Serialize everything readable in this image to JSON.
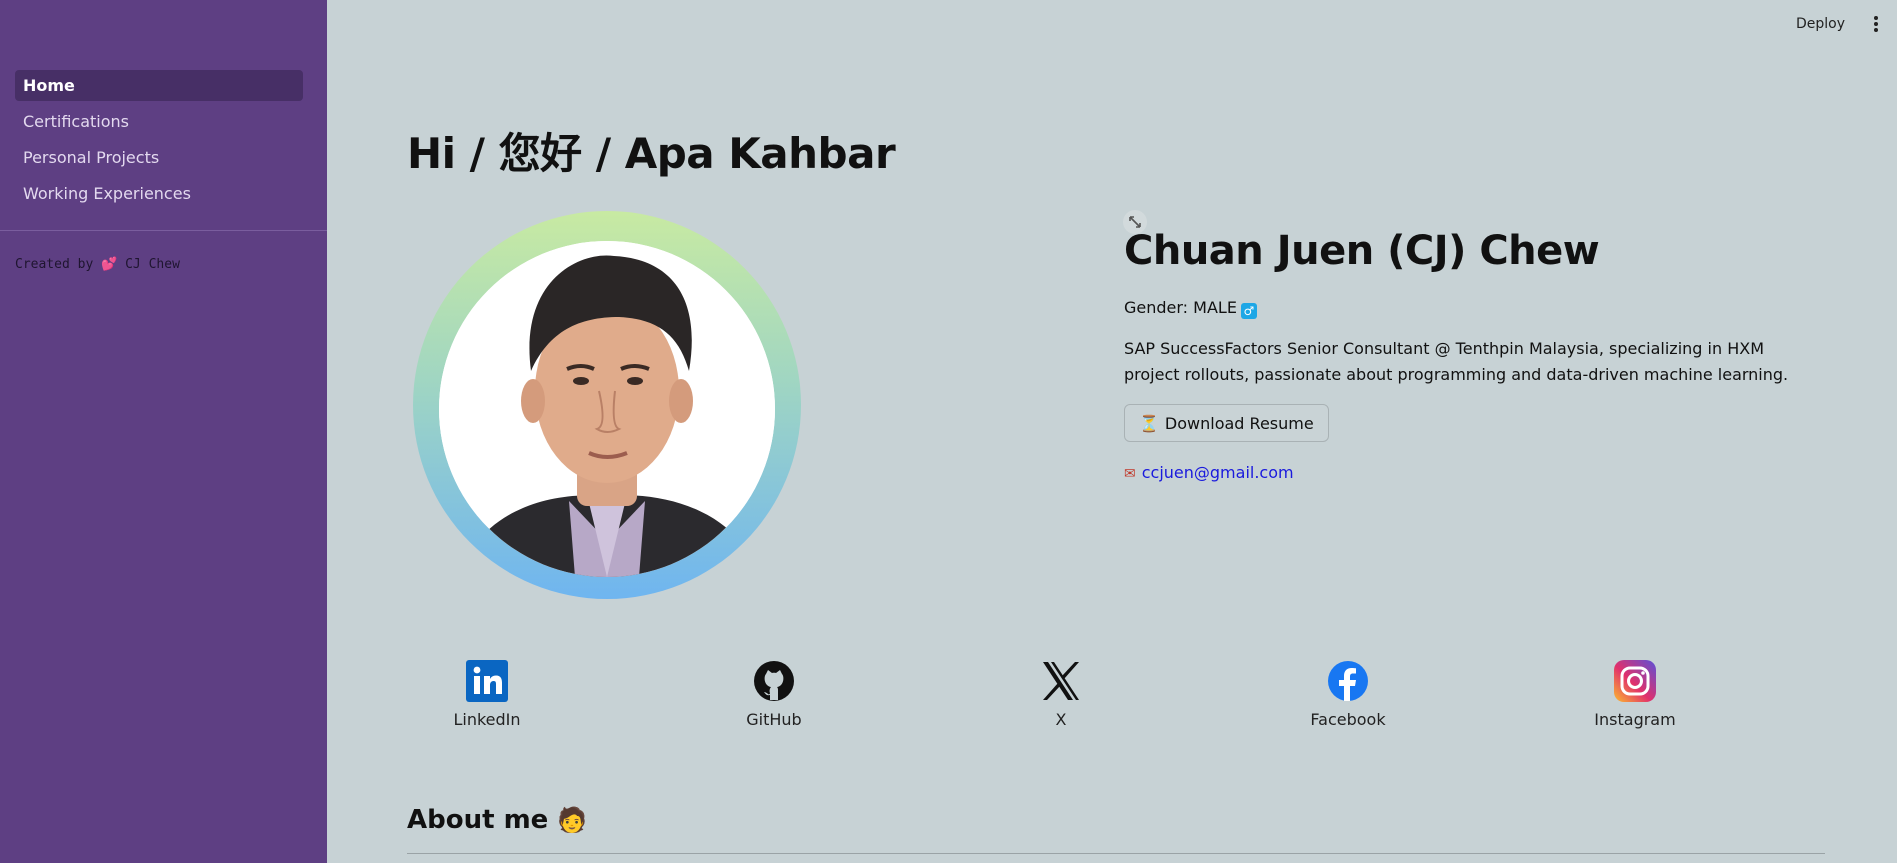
{
  "topbar": {
    "deploy_label": "Deploy"
  },
  "sidebar": {
    "items": [
      {
        "label": "Home",
        "active": true
      },
      {
        "label": "Certifications",
        "active": false
      },
      {
        "label": "Personal Projects",
        "active": false
      },
      {
        "label": "Working Experiences",
        "active": false
      }
    ],
    "credit_prefix": "Created by ",
    "credit_heart": "💕",
    "credit_name": " CJ Chew"
  },
  "main": {
    "greeting": "Hi / 您好 / Apa Kahbar",
    "name": "Chuan Juen (CJ) Chew",
    "gender_label": "Gender: MALE",
    "bio": "SAP SuccessFactors Senior Consultant @ Tenthpin Malaysia, specializing in HXM project rollouts, passionate about programming and data-driven machine learning.",
    "download_label": "Download Resume",
    "email": "ccjuen@gmail.com",
    "socials": [
      {
        "label": "LinkedIn",
        "icon": "linkedin-icon"
      },
      {
        "label": "GitHub",
        "icon": "github-icon"
      },
      {
        "label": "X",
        "icon": "x-icon"
      },
      {
        "label": "Facebook",
        "icon": "facebook-icon"
      },
      {
        "label": "Instagram",
        "icon": "instagram-icon"
      }
    ],
    "about_heading": "About me",
    "about_emoji": "🧑"
  },
  "colors": {
    "sidebar_bg": "#5e3f83",
    "main_bg": "#c7d2d5",
    "link": "#1a1add",
    "linkedin": "#0a66c2",
    "facebook": "#1877f2"
  }
}
